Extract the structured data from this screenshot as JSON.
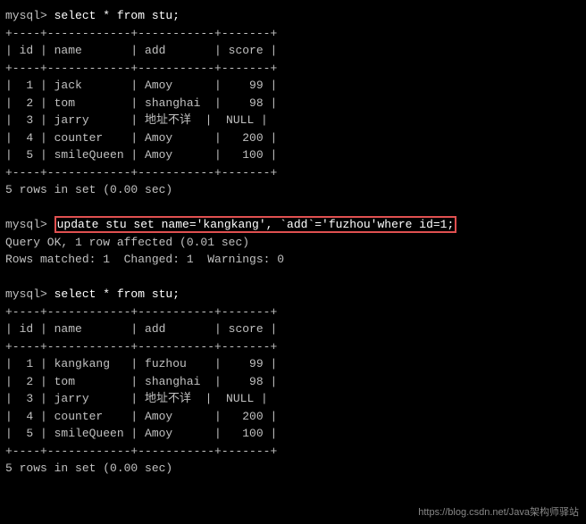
{
  "terminal": {
    "lines": [
      {
        "id": "l1",
        "type": "prompt-cmd",
        "prompt": "mysql> ",
        "cmd": "select * from stu;"
      },
      {
        "id": "l2",
        "type": "border",
        "text": "+----+------------+-----------+-------+"
      },
      {
        "id": "l3",
        "type": "header",
        "text": "| id | name       | add       | score |"
      },
      {
        "id": "l4",
        "type": "border",
        "text": "+----+------------+-----------+-------+"
      },
      {
        "id": "l5",
        "type": "row",
        "text": "|  1 | jack       | Amoy      |    99 |"
      },
      {
        "id": "l6",
        "type": "row",
        "text": "|  2 | tom        | shanghai  |    98 |"
      },
      {
        "id": "l7",
        "type": "row",
        "text": "|  3 | jarry      | 地址不详  |  NULL |"
      },
      {
        "id": "l8",
        "type": "row",
        "text": "|  4 | counter    | Amoy      |   200 |"
      },
      {
        "id": "l9",
        "type": "row",
        "text": "|  5 | smileQueen | Amoy      |   100 |"
      },
      {
        "id": "l10",
        "type": "border",
        "text": "+----+------------+-----------+-------+"
      },
      {
        "id": "l11",
        "type": "info",
        "text": "5 rows in set (0.00 sec)"
      },
      {
        "id": "l12",
        "type": "blank",
        "text": ""
      },
      {
        "id": "l13",
        "type": "prompt-update",
        "prompt": "mysql> ",
        "cmd": "update stu set name='kangkang', `add`='fuzhou'where id=1;"
      },
      {
        "id": "l14",
        "type": "info",
        "text": "Query OK, 1 row affected (0.01 sec)"
      },
      {
        "id": "l15",
        "type": "info",
        "text": "Rows matched: 1  Changed: 1  Warnings: 0"
      },
      {
        "id": "l16",
        "type": "blank",
        "text": ""
      },
      {
        "id": "l17",
        "type": "prompt-cmd",
        "prompt": "mysql> ",
        "cmd": "select * from stu;"
      },
      {
        "id": "l18",
        "type": "border",
        "text": "+----+------------+-----------+-------+"
      },
      {
        "id": "l19",
        "type": "header",
        "text": "| id | name       | add       | score |"
      },
      {
        "id": "l20",
        "type": "border",
        "text": "+----+------------+-----------+-------+"
      },
      {
        "id": "l21",
        "type": "row",
        "text": "|  1 | kangkang   | fuzhou    |    99 |"
      },
      {
        "id": "l22",
        "type": "row",
        "text": "|  2 | tom        | shanghai  |    98 |"
      },
      {
        "id": "l23",
        "type": "row",
        "text": "|  3 | jarry      | 地址不详  |  NULL |"
      },
      {
        "id": "l24",
        "type": "row",
        "text": "|  4 | counter    | Amoy      |   200 |"
      },
      {
        "id": "l25",
        "type": "row",
        "text": "|  5 | smileQueen | Amoy      |   100 |"
      },
      {
        "id": "l26",
        "type": "border",
        "text": "+----+------------+-----------+-------+"
      },
      {
        "id": "l27",
        "type": "info",
        "text": "5 rows in set (0.00 sec)"
      }
    ],
    "watermark": "https://blog.csdn.net/Java架构师驿站"
  }
}
